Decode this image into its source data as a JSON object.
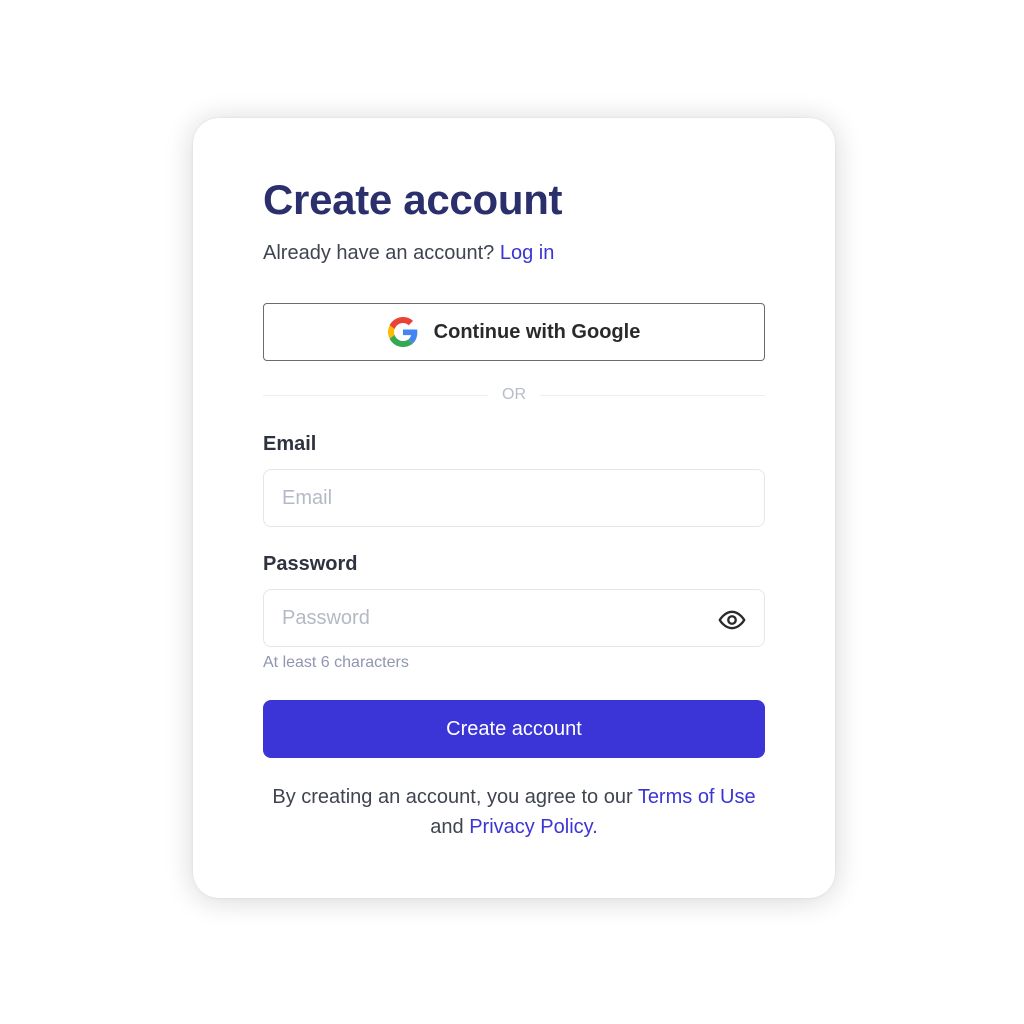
{
  "title": "Create account",
  "login_prompt": {
    "text": "Already have an account?",
    "link": "Log in"
  },
  "google_button": {
    "label": "Continue with Google",
    "icon": "google-icon"
  },
  "divider_text": "OR",
  "email": {
    "label": "Email",
    "placeholder": "Email",
    "value": ""
  },
  "password": {
    "label": "Password",
    "placeholder": "Password",
    "value": "",
    "toggle_icon": "eye-icon",
    "hint": "At least 6 characters"
  },
  "submit_label": "Create account",
  "terms": {
    "prefix": "By creating an account, you agree to our",
    "terms_link": "Terms of Use",
    "middle": "and",
    "privacy_link": "Privacy Policy",
    "suffix": "."
  },
  "colors": {
    "accent": "#3b35d8",
    "title": "#2b2f6b",
    "link": "#3b35d6",
    "hint": "#8f96b0"
  }
}
